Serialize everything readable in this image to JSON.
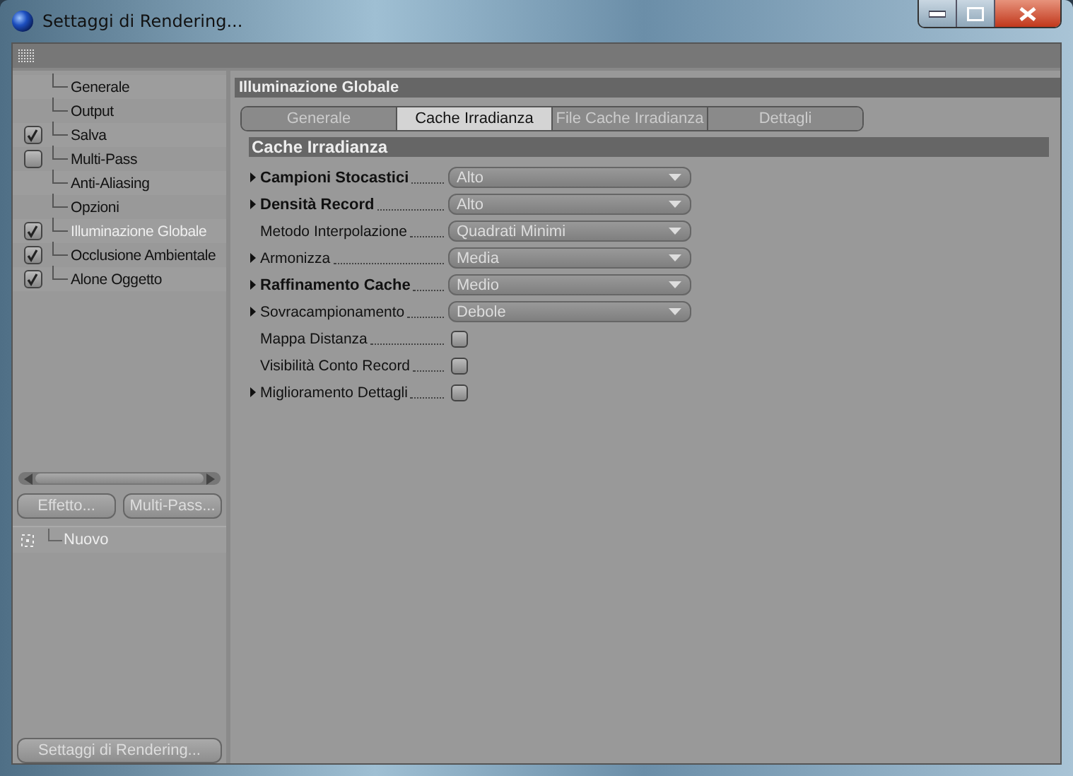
{
  "window": {
    "title": "Settaggi di Rendering..."
  },
  "sidebar": {
    "items": [
      {
        "label": "Generale",
        "kind": "plain",
        "selected": false
      },
      {
        "label": "Output",
        "kind": "plain",
        "selected": false
      },
      {
        "label": "Salva",
        "kind": "checkbox",
        "checked": true,
        "selected": false
      },
      {
        "label": "Multi-Pass",
        "kind": "checkbox",
        "checked": false,
        "selected": false
      },
      {
        "label": "Anti-Aliasing",
        "kind": "plain",
        "selected": false
      },
      {
        "label": "Opzioni",
        "kind": "plain",
        "selected": false
      },
      {
        "label": "Illuminazione Globale",
        "kind": "checkbox",
        "checked": true,
        "selected": true
      },
      {
        "label": "Occlusione Ambientale",
        "kind": "checkbox",
        "checked": true,
        "selected": false
      },
      {
        "label": "Alone Oggetto",
        "kind": "checkbox",
        "checked": true,
        "selected": false
      }
    ],
    "buttons": [
      "Effetto...",
      "Multi-Pass..."
    ],
    "presets": [
      {
        "label": "Nuovo"
      }
    ],
    "footer_button": "Settaggi di Rendering..."
  },
  "panel": {
    "title": "Illuminazione Globale",
    "tabs": [
      {
        "label": "Generale",
        "selected": false
      },
      {
        "label": "Cache Irradianza",
        "selected": true
      },
      {
        "label": "File Cache Irradianza",
        "selected": false
      },
      {
        "label": "Dettagli",
        "selected": false
      }
    ],
    "section": "Cache Irradianza",
    "settings": [
      {
        "label": "Campioni Stocastici",
        "kind": "dropdown",
        "value": "Alto",
        "expandable": true,
        "bold": true
      },
      {
        "label": "Densità Record",
        "kind": "dropdown",
        "value": "Alto",
        "expandable": true,
        "bold": true
      },
      {
        "label": "Metodo Interpolazione",
        "kind": "dropdown",
        "value": "Quadrati Minimi",
        "expandable": false,
        "bold": false
      },
      {
        "label": "Armonizza",
        "kind": "dropdown",
        "value": "Media",
        "expandable": true,
        "bold": false
      },
      {
        "label": "Raffinamento Cache",
        "kind": "dropdown",
        "value": "Medio",
        "expandable": true,
        "bold": true
      },
      {
        "label": "Sovracampionamento",
        "kind": "dropdown",
        "value": "Debole",
        "expandable": true,
        "bold": false
      },
      {
        "label": "Mappa Distanza",
        "kind": "checkbox",
        "checked": false,
        "expandable": false,
        "bold": false
      },
      {
        "label": "Visibilità Conto Record",
        "kind": "checkbox",
        "checked": false,
        "expandable": false,
        "bold": false
      },
      {
        "label": "Miglioramento Dettagli",
        "kind": "checkbox",
        "checked": false,
        "expandable": true,
        "bold": false
      }
    ]
  }
}
